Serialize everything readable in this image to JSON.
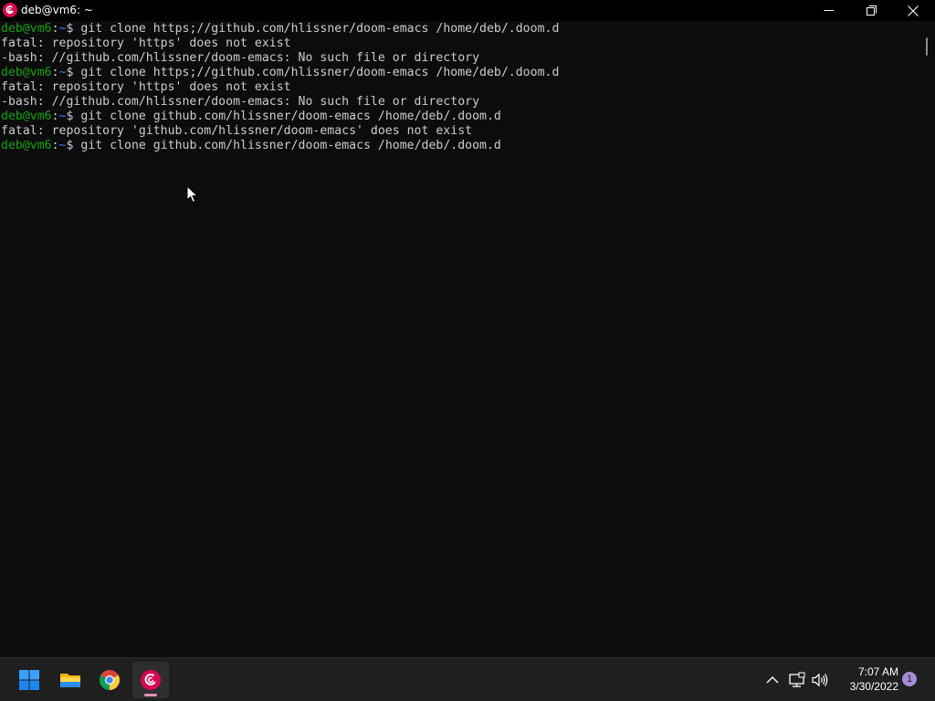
{
  "window": {
    "title": "deb@vm6: ~",
    "icon": "debian-swirl-icon",
    "controls": [
      "minimize-icon",
      "maximize-icon",
      "close-icon"
    ]
  },
  "terminal": {
    "colors": {
      "background": "#0c0c0c",
      "text": "#cccccc",
      "user": "#13a10e",
      "path": "#3b78ff"
    },
    "lines": [
      {
        "user": "deb@vm6",
        "sep": ":",
        "path": "~",
        "prompt": "$ ",
        "text": "git clone https;//github.com/hlissner/doom-emacs /home/deb/.doom.d"
      },
      {
        "text": "fatal: repository 'https' does not exist"
      },
      {
        "text": "-bash: //github.com/hlissner/doom-emacs: No such file or directory"
      },
      {
        "user": "deb@vm6",
        "sep": ":",
        "path": "~",
        "prompt": "$ ",
        "text": "git clone https;//github.com/hlissner/doom-emacs /home/deb/.doom.d"
      },
      {
        "text": "fatal: repository 'https' does not exist"
      },
      {
        "text": "-bash: //github.com/hlissner/doom-emacs: No such file or directory"
      },
      {
        "user": "deb@vm6",
        "sep": ":",
        "path": "~",
        "prompt": "$ ",
        "text": "git clone github.com/hlissner/doom-emacs /home/deb/.doom.d"
      },
      {
        "text": "fatal: repository 'github.com/hlissner/doom-emacs' does not exist"
      },
      {
        "user": "deb@vm6",
        "sep": ":",
        "path": "~",
        "prompt": "$ ",
        "text": "git clone github.com/hlissner/doom-emacs /home/deb/.doom.d"
      }
    ]
  },
  "taskbar": {
    "apps": [
      "windows-start-icon",
      "file-explorer-icon",
      "chrome-icon",
      "debian-terminal-icon"
    ],
    "active_app": "debian-terminal-icon",
    "tray": [
      "chevron-up-icon",
      "network-icon",
      "volume-icon"
    ],
    "clock": {
      "time": "7:07 AM",
      "date": "3/30/2022"
    },
    "notification_count": "1",
    "accent": "#e58fb5"
  }
}
